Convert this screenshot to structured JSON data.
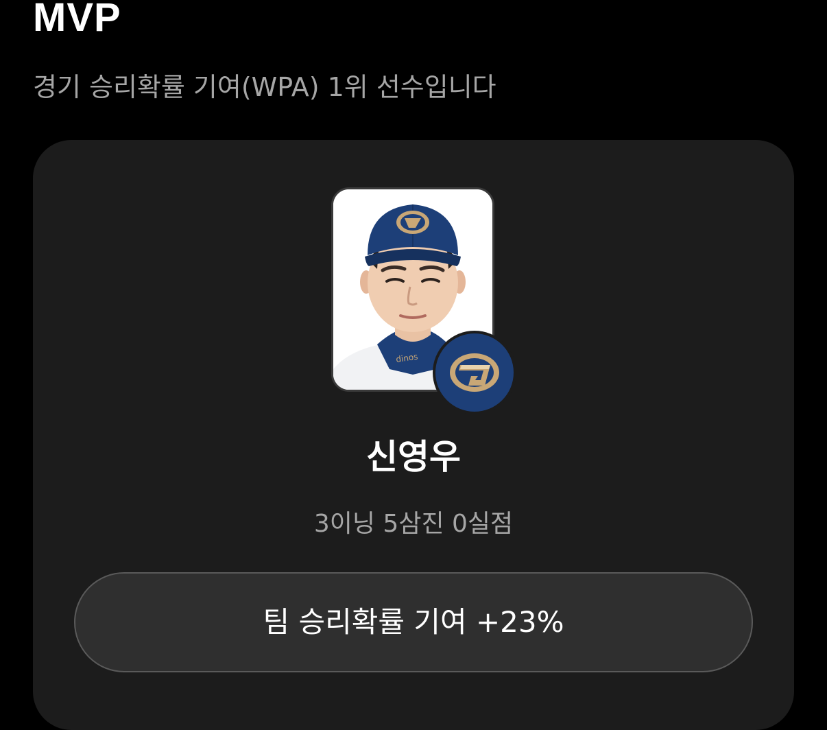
{
  "header": {
    "title": "MVP",
    "subtitle": "경기 승리확률 기여(WPA) 1위 선수입니다"
  },
  "mvp_card": {
    "player_photo_icon": "player-portrait",
    "team_logo_icon": "nc-dinos-logo",
    "player_name": "신영우",
    "stats": "3이닝 5삼진 0실점",
    "wpa_button_label": "팀 승리확률 기여 +23%"
  },
  "colors": {
    "background": "#000000",
    "card": "#1c1c1c",
    "button": "#2f2f2f",
    "button_border": "#5a5a5a",
    "secondary_text": "#a6a6a6",
    "team_navy": "#1d3f78",
    "team_gold": "#c9a776"
  }
}
